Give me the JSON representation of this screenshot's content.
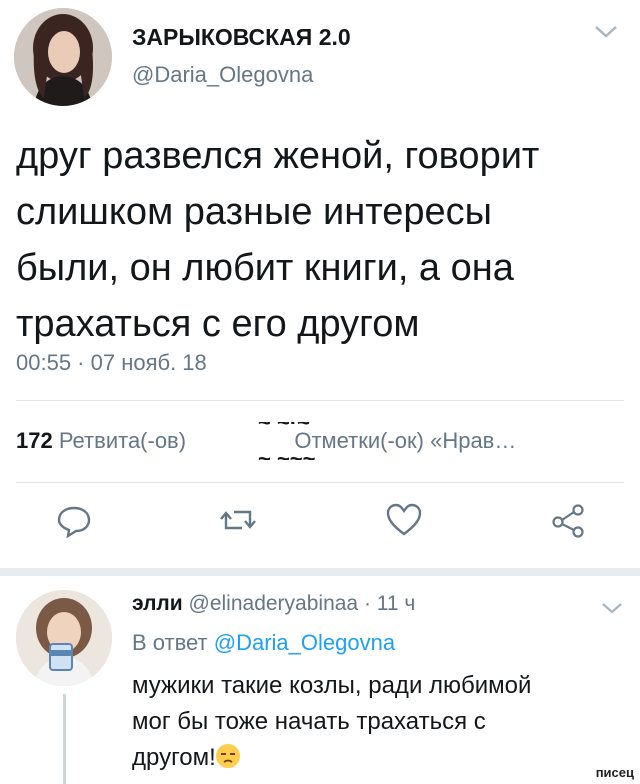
{
  "tweet": {
    "display_name": "ЗАРЫКОВСКАЯ 2.0",
    "handle": "@Daria_Olegovna",
    "text_lines": [
      "друг развелся женой, говорит",
      "слишком разные интересы",
      "были, он любит книги, а она",
      "трахаться с его другом"
    ],
    "timestamp": "00:55 · 07 нояб. 18",
    "retweets_count": "172",
    "retweets_label": "Ретвита(-ов)",
    "likes_label": "Отметки(-ок) «Нрав…",
    "likes_count_partial_top": "~ ~·~",
    "likes_count_partial_bottom": "~ ~~~"
  },
  "reply": {
    "display_name": "элли",
    "handle": "@elinaderyabinaa",
    "time": "· 11 ч",
    "in_reply_to_prefix": "В ответ",
    "in_reply_to_handle": "@Daria_Olegovna",
    "text_lines": [
      "мужики такие козлы, ради любимой",
      "мог бы тоже начать трахаться с",
      "другом!"
    ]
  },
  "icons": {
    "reply": "reply-icon",
    "retweet": "retweet-icon",
    "like": "heart-icon",
    "share": "share-icon",
    "menu": "chevron-down-icon",
    "emoji": "unamused-face-emoji"
  },
  "colors": {
    "link": "#1da1f2",
    "muted": "#657786",
    "text": "#14171a"
  },
  "watermark": "писец"
}
